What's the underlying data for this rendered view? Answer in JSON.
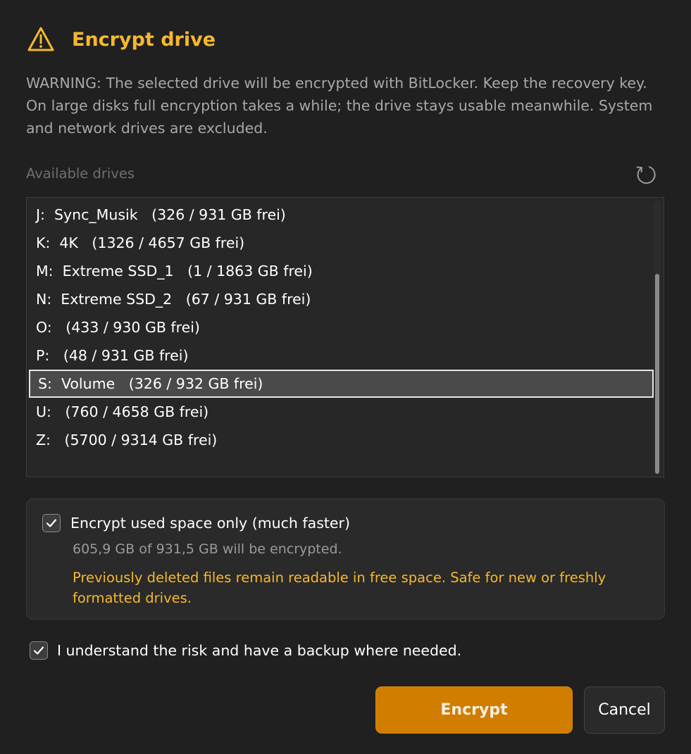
{
  "dialog": {
    "title": "Encrypt drive",
    "icon": "warning-triangle-icon",
    "accent_color": "#f5b82e",
    "warning_text": "WARNING: The selected drive will be encrypted with BitLocker. Keep the recovery key. On large disks full encryption takes a while; the drive stays usable meanwhile. System and network drives are excluded."
  },
  "drives": {
    "label": "Available drives",
    "refresh_icon": "refresh-icon",
    "selected_index": 6,
    "items": [
      {
        "text": "J:  Sync_Musik   (326 / 931 GB frei)"
      },
      {
        "text": "K:  4K   (1326 / 4657 GB frei)"
      },
      {
        "text": "M:  Extreme SSD_1   (1 / 1863 GB frei)"
      },
      {
        "text": "N:  Extreme SSD_2   (67 / 931 GB frei)"
      },
      {
        "text": "O:   (433 / 930 GB frei)"
      },
      {
        "text": "P:   (48 / 931 GB frei)"
      },
      {
        "text": "S:  Volume   (326 / 932 GB frei)"
      },
      {
        "text": "U:   (760 / 4658 GB frei)"
      },
      {
        "text": "Z:   (5700 / 9314 GB frei)"
      }
    ]
  },
  "options": {
    "used_space_only": {
      "label": "Encrypt used space only (much faster)",
      "checked": true,
      "summary": "605,9 GB of 931,5 GB will be encrypted.",
      "note": "Previously deleted files remain readable in free space. Safe for new or freshly formatted drives."
    },
    "risk_ack": {
      "label": "I understand the risk and have a backup where needed.",
      "checked": true
    }
  },
  "buttons": {
    "encrypt_label": "Encrypt",
    "cancel_label": "Cancel",
    "primary_color": "#d07d00"
  }
}
